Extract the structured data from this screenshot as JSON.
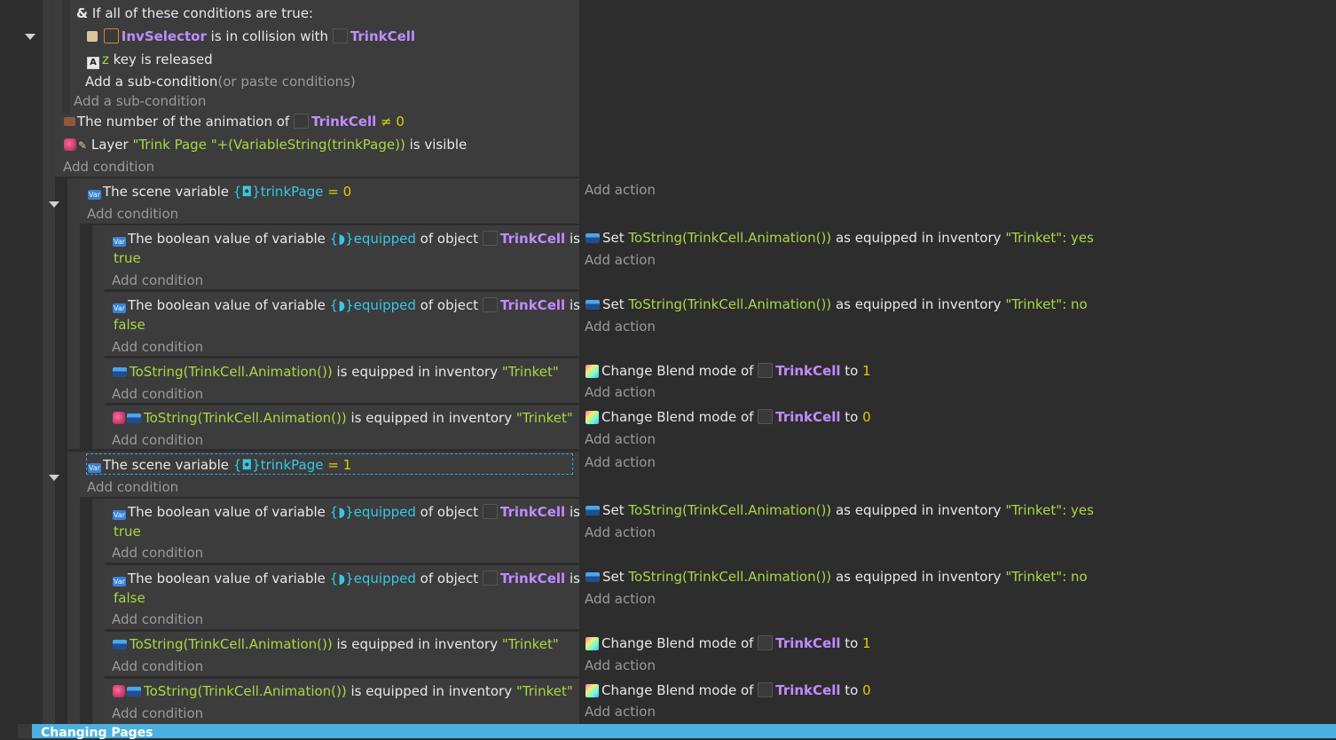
{
  "top_group": {
    "header": "If all of these conditions are true:",
    "cond1": {
      "obj1": "InvSelector",
      "mid": "is in collision with",
      "obj2": "TrinkCell"
    },
    "cond2": {
      "key": "z",
      "rest": "key is released"
    },
    "add_sub_paste": "Add a sub-condition",
    "add_sub_paste_hint": "(or paste conditions)",
    "add_sub": "Add a sub-condition",
    "anim": {
      "pre": "The number of the animation of",
      "obj": "TrinkCell",
      "op": "≠",
      "val": "0"
    },
    "layer": {
      "pre": "Layer",
      "str": "\"Trink Page \"",
      "expr": "+(VariableString(trinkPage))",
      "post": "is visible"
    },
    "add_condition": "Add condition"
  },
  "blocks": [
    {
      "scene": {
        "pre": "The scene variable",
        "var": "trinkPage",
        "eq": "=",
        "val": "0"
      },
      "add_condition": "Add condition",
      "add_action": "Add action",
      "rows": [
        {
          "c_pre": "The boolean value of variable",
          "c_var": "equipped",
          "c_mid": "of object",
          "c_obj": "TrinkCell",
          "c_is": "is",
          "c_val": "true",
          "add_condition": "Add condition",
          "a_pre": "Set",
          "a_expr": "ToString(TrinkCell.Animation())",
          "a_mid": "as equipped in inventory",
          "a_str": "\"Trinket\"",
          "a_colon": ": ",
          "a_val": "yes",
          "add_action": "Add action"
        },
        {
          "c_pre": "The boolean value of variable",
          "c_var": "equipped",
          "c_mid": "of object",
          "c_obj": "TrinkCell",
          "c_is": "is",
          "c_val": "false",
          "add_condition": "Add condition",
          "a_pre": "Set",
          "a_expr": "ToString(TrinkCell.Animation())",
          "a_mid": "as equipped in inventory",
          "a_str": "\"Trinket\"",
          "a_colon": ": ",
          "a_val": "no",
          "add_action": "Add action"
        },
        {
          "c_expr": "ToString(TrinkCell.Animation())",
          "c_mid": "is equipped in inventory",
          "c_str": "\"Trinket\"",
          "add_condition": "Add condition",
          "a_pre": "Change Blend mode of",
          "a_obj": "TrinkCell",
          "a_to": "to",
          "a_val": "1",
          "add_action": "Add action"
        },
        {
          "c_expr": "ToString(TrinkCell.Animation())",
          "c_mid": "is equipped in inventory",
          "c_str": "\"Trinket\"",
          "add_condition": "Add condition",
          "a_pre": "Change Blend mode of",
          "a_obj": "TrinkCell",
          "a_to": "to",
          "a_val": "0",
          "add_action": "Add action"
        }
      ]
    },
    {
      "scene": {
        "pre": "The scene variable",
        "var": "trinkPage",
        "eq": "=",
        "val": "1"
      },
      "add_condition": "Add condition",
      "add_action": "Add action",
      "rows": [
        {
          "c_pre": "The boolean value of variable",
          "c_var": "equipped",
          "c_mid": "of object",
          "c_obj": "TrinkCell",
          "c_is": "is",
          "c_val": "true",
          "add_condition": "Add condition",
          "a_pre": "Set",
          "a_expr": "ToString(TrinkCell.Animation())",
          "a_mid": "as equipped in inventory",
          "a_str": "\"Trinket\"",
          "a_colon": ": ",
          "a_val": "yes",
          "add_action": "Add action"
        },
        {
          "c_pre": "The boolean value of variable",
          "c_var": "equipped",
          "c_mid": "of object",
          "c_obj": "TrinkCell",
          "c_is": "is",
          "c_val": "false",
          "add_condition": "Add condition",
          "a_pre": "Set",
          "a_expr": "ToString(TrinkCell.Animation())",
          "a_mid": "as equipped in inventory",
          "a_str": "\"Trinket\"",
          "a_colon": ": ",
          "a_val": "no",
          "add_action": "Add action"
        },
        {
          "c_expr": "ToString(TrinkCell.Animation())",
          "c_mid": "is equipped in inventory",
          "c_str": "\"Trinket\"",
          "add_condition": "Add condition",
          "a_pre": "Change Blend mode of",
          "a_obj": "TrinkCell",
          "a_to": "to",
          "a_val": "1",
          "add_action": "Add action"
        },
        {
          "c_expr": "ToString(TrinkCell.Animation())",
          "c_mid": "is equipped in inventory",
          "c_str": "\"Trinket\"",
          "add_condition": "Add condition",
          "a_pre": "Change Blend mode of",
          "a_obj": "TrinkCell",
          "a_to": "to",
          "a_val": "0",
          "add_action": "Add action"
        }
      ]
    }
  ],
  "bottom_bar_label": "Changing Pages",
  "colors": {
    "object": "#c08cff",
    "string": "#a8d844",
    "number": "#d7d200",
    "variable": "#35c8e8",
    "bottom_bar": "#4ab0e0"
  }
}
